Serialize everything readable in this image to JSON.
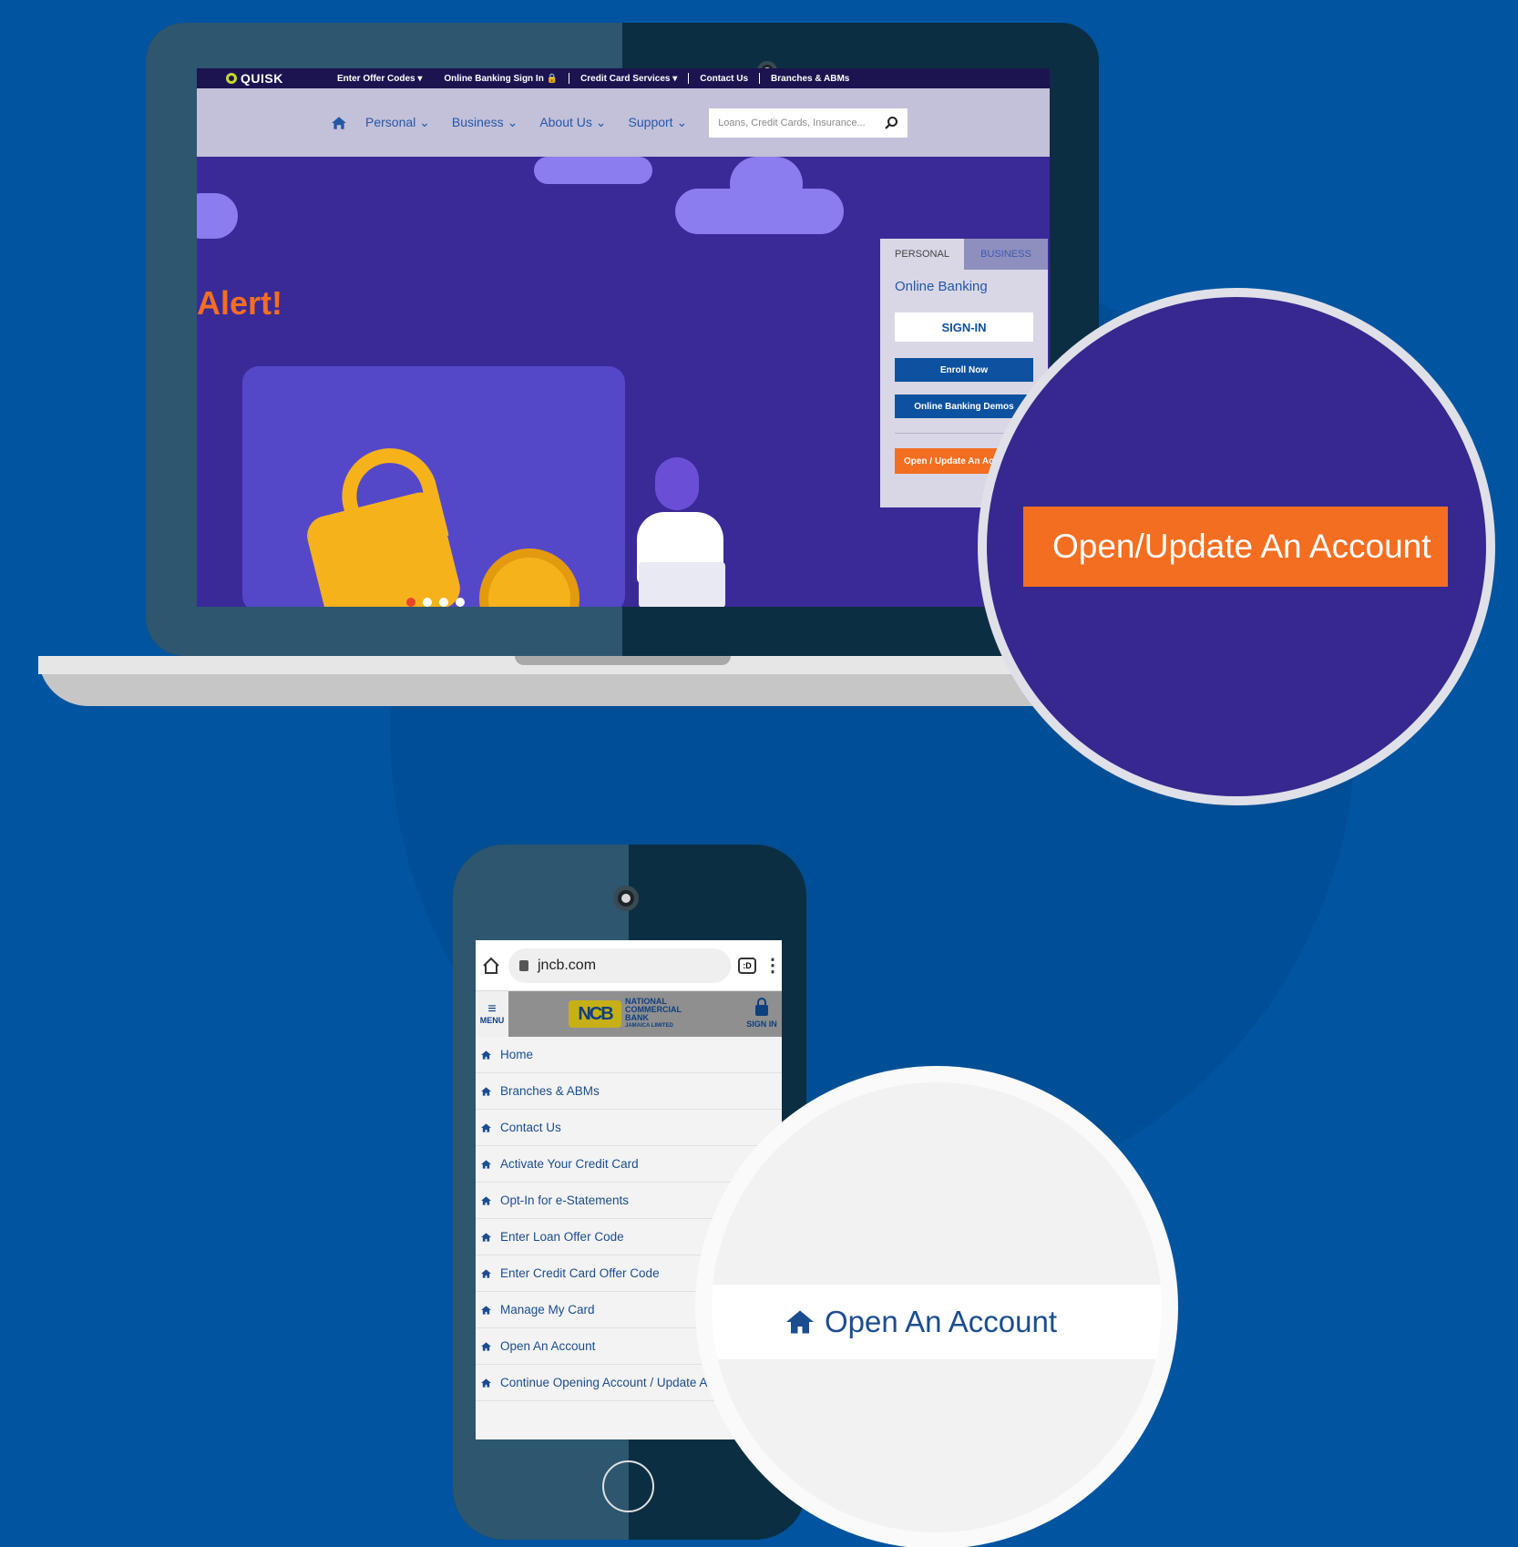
{
  "laptop": {
    "topbar": {
      "brand": "QUISK",
      "items": [
        "Enter Offer Codes ▾",
        "Online Banking Sign In 🔒",
        "Credit Card Services ▾",
        "Contact Us",
        "Branches & ABMs"
      ]
    },
    "nav": {
      "items": [
        "Personal ⌄",
        "Business ⌄",
        "About Us ⌄",
        "Support ⌄"
      ],
      "search_placeholder": "Loans, Credit Cards, Insurance..."
    },
    "hero": {
      "headline": "Alert!"
    },
    "online_banking": {
      "tabs": [
        "PERSONAL",
        "BUSINESS"
      ],
      "title": "Online Banking",
      "signin": "SIGN-IN",
      "enroll": "Enroll Now",
      "demos": "Online Banking Demos",
      "open_update": "Open / Update An Account"
    },
    "zoom_callout": "Open/Update An Account"
  },
  "phone": {
    "url": "jncb.com",
    "tabs_count": ":D",
    "menu_label": "MENU",
    "signin_label": "SIGN IN",
    "logo_mark": "NCB",
    "logo_lines": [
      "NATIONAL",
      "COMMERCIAL",
      "BANK",
      "JAMAICA LIMITED"
    ],
    "menu_items": [
      "Home",
      "Branches & ABMs",
      "Contact Us",
      "Activate Your Credit Card",
      "Opt-In for e-Statements",
      "Enter Loan Offer Code",
      "Enter Credit Card Offer Code",
      "Manage My Card",
      "Open An Account",
      "Continue Opening Account / Update Account"
    ],
    "zoom_callout": "Open An Account"
  },
  "colors": {
    "background": "#0054a0",
    "accent_orange": "#f36e21",
    "nav_blue": "#2457a7",
    "hero_purple": "#3a2a98"
  }
}
